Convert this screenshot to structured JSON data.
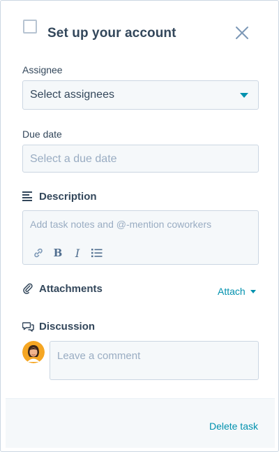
{
  "header": {
    "title": "Set up your account",
    "close_icon": "close-icon",
    "checkbox_checked": false
  },
  "assignee": {
    "label": "Assignee",
    "value": "Select assignees",
    "caret_icon": "caret-down-icon"
  },
  "due_date": {
    "label": "Due date",
    "placeholder": "Select a due date"
  },
  "description": {
    "label": "Description",
    "icon": "text-lines-icon",
    "placeholder": "Add task notes and @-mention coworkers",
    "toolbar": {
      "link_icon": "link-icon",
      "bold_label": "B",
      "italic_label": "I",
      "list_icon": "bulleted-list-icon"
    }
  },
  "attachments": {
    "label": "Attachments",
    "icon": "paperclip-icon",
    "attach_label": "Attach"
  },
  "discussion": {
    "label": "Discussion",
    "icon": "speech-bubbles-icon",
    "comment_placeholder": "Leave a comment"
  },
  "footer": {
    "delete_label": "Delete task"
  },
  "colors": {
    "accent": "#0091ae",
    "text": "#33475b",
    "placeholder": "#99acc2",
    "field_bg": "#f5f8fa",
    "border": "#cbd6e2"
  }
}
